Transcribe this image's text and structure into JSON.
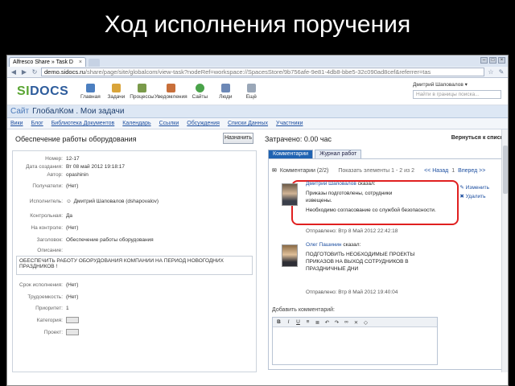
{
  "slide_title": "Ход исполнения поручения",
  "browser": {
    "tab_title": "Alfresco Share » Task D",
    "url_domain": "demo.sidocs.ru",
    "url_path": "/share/page/site/globalcom/view-task?nodeRef=workspace://SpacesStore/9b756afe-9e81-4db8-bbe5-32c090ad8cef&referrer=tas"
  },
  "app": {
    "logo_a": "SI",
    "logo_b": "DOCS",
    "menu": [
      "Главная",
      "Задачи",
      "Процессы",
      "Уведомления",
      "Сайты",
      "Люди",
      "Ещё"
    ],
    "user": "Дмитрий Шаповалов ▾",
    "search_placeholder": "Найти в границы поиска..."
  },
  "site": {
    "site_label": "Сайт",
    "name": "ГлобалКом . Мои задачи",
    "nav": [
      "Вики",
      "Блог",
      "Библиотека Документов",
      "Календарь",
      "Ссылки",
      "Обсуждения",
      "Списки Данных",
      "Участники"
    ]
  },
  "task": {
    "title": "Обеспечение работы оборудования",
    "assign_label": "Назначить",
    "fields": [
      {
        "label": "Номер:",
        "value": "12-17"
      },
      {
        "label": "Дата создания:",
        "value": "Вт 08 май 2012 19:18:17"
      },
      {
        "label": "Автор:",
        "value": "opashinin"
      },
      {
        "label": "Получатели:",
        "value": "(Нет)"
      },
      {
        "label": "Исполнитель:",
        "value": "Дмитрий Шаповалов (dshapovalov)"
      },
      {
        "label": "Контрольная:",
        "value": "Да"
      },
      {
        "label": "На контроле:",
        "value": "(Нет)"
      },
      {
        "label": "Заголовок:",
        "value": "Обеспечение работы оборудования"
      },
      {
        "label": "Описание:",
        "value": ""
      }
    ],
    "description": "ОБЕСПЕЧИТЬ РАБОТУ ОБОРУДОВАНИЯ КОМПАНИИ НА ПЕРИОД НОВОГОДНИХ ПРАЗДНИКОВ !",
    "fields2": [
      {
        "label": "Срок исполнения:",
        "value": "(Нет)"
      },
      {
        "label": "Трудоемкость:",
        "value": "(Нет)"
      },
      {
        "label": "Приоритет:",
        "value": "1"
      },
      {
        "label": "Категория:",
        "value": ""
      },
      {
        "label": "Проект:",
        "value": ""
      }
    ]
  },
  "right": {
    "spent": "Затрачено: 0.00 час",
    "back": "Вернуться к списку",
    "tabs": [
      "Комментарии",
      "Журнал работ"
    ],
    "comments_title": "Комментарии (2/2)",
    "paging": "Показать элементы 1 - 2 из 2",
    "prev": "<< Назад",
    "page": "1",
    "next": "Вперед >>",
    "comments": [
      {
        "author": "Дмитрий Шаповалов",
        "said": "сказал:",
        "lines": [
          "Приказы подготовлены, сотрудники",
          "извещены.",
          "",
          "Необходимо согласование со службой безопасности."
        ],
        "edit": "Изменить",
        "delete": "Удалить",
        "sent": "Отправлено: Втр 8 Май 2012 22:42:18"
      },
      {
        "author": "Олег Пашинин",
        "said": "сказал:",
        "lines": [
          "ПОДГОТОВИТЬ НЕОБХОДИМЫЕ ПРОЕКТЫ",
          "ПРИКАЗОВ НА ВЫХОД СОТРУДНИКОВ В",
          "ПРАЗДНИЧНЫЕ ДНИ"
        ],
        "edit": "",
        "delete": "",
        "sent": "Отправлено: Втр 8 Май 2012 19:40:04"
      }
    ],
    "add_comment": "Добавить комментарий:"
  }
}
